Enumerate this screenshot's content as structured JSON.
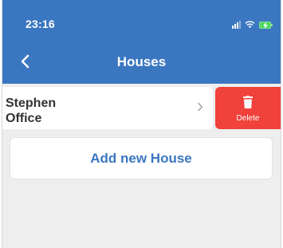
{
  "status_bar": {
    "time": "23:16",
    "icons": [
      "signal-icon",
      "wifi-icon",
      "battery-charging-icon"
    ]
  },
  "header": {
    "back_icon": "chevron-left-icon",
    "title": "Houses"
  },
  "houses": [
    {
      "name": "Stephen\nOffice",
      "chevron_icon": "chevron-right-icon"
    }
  ],
  "row_actions": {
    "delete_label": "Delete",
    "delete_icon": "trash-icon"
  },
  "add_button": {
    "label": "Add new House"
  },
  "colors": {
    "accent": "#3b77c0",
    "delete": "#f0413a",
    "background": "#eeeeee",
    "card": "#ffffff",
    "text": "#333333",
    "battery": "#4cd964"
  }
}
